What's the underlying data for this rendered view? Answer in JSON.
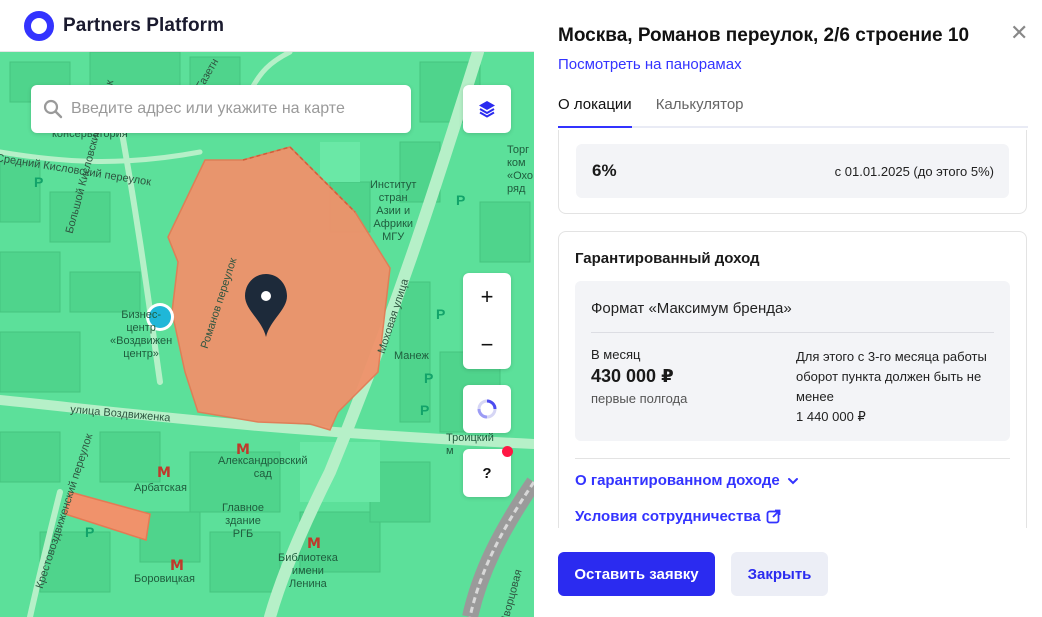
{
  "header": {
    "brand": "Partners Platform"
  },
  "map": {
    "search_placeholder": "Введите адрес или укажите на карте",
    "zoom_in": "+",
    "zoom_out": "−",
    "help": "?",
    "labels": {
      "conservatory": "консерватория",
      "kislovsky": "Средний Кисловский переулок",
      "bolshoy_kislovsky": "Большой Кисловский переулок",
      "romanov": "Романов переулок",
      "mokhovaya": "Моховая улица",
      "vozdvizhenka": "улица Воздвиженка",
      "krestovozdvizhensky": "Крестовоздвиженский переулок",
      "institute": "Институт\nстран\nАзии и\nАфрики\nМГУ",
      "business_center": "Бизнес-\nцентр\n«Воздвижен\nцентр»",
      "manezh": "Манеж",
      "alexander_garden": "Александровский\nсад",
      "arbatskaya": "Арбатская",
      "borovitskaya": "Боровицкая",
      "rgb": "Главное\nздание\nРГБ",
      "lenin_library": "Библиотека\nимени\nЛенина",
      "troitsky": "Троицкий\nм",
      "trade": "Торг\nком\n«Охо\nряд",
      "gazetny": "Газетн",
      "dvortsovaya": "Дворцовая"
    },
    "parking_glyph": "P"
  },
  "panel": {
    "title": "Москва, Романов переулок, 2/6 строение 10",
    "panorama_link": "Посмотреть на панорамах",
    "tabs": [
      "О локации",
      "Калькулятор"
    ],
    "rate": {
      "value": "6%",
      "note": "с 01.01.2025 (до этого 5%)"
    },
    "guaranteed": {
      "title": "Гарантированный доход",
      "format": "Формат «Максимум бренда»",
      "per_month_label": "В месяц",
      "amount": "430 000 ₽",
      "period": "первые полгода",
      "condition": "Для этого с 3-го месяца работы оборот пункта должен быть не менее\n1 440 000 ₽"
    },
    "links": {
      "about_income": "О гарантированном доходе",
      "terms": "Условия сотрудничества"
    },
    "buttons": {
      "submit": "Оставить заявку",
      "close": "Закрыть"
    }
  }
}
